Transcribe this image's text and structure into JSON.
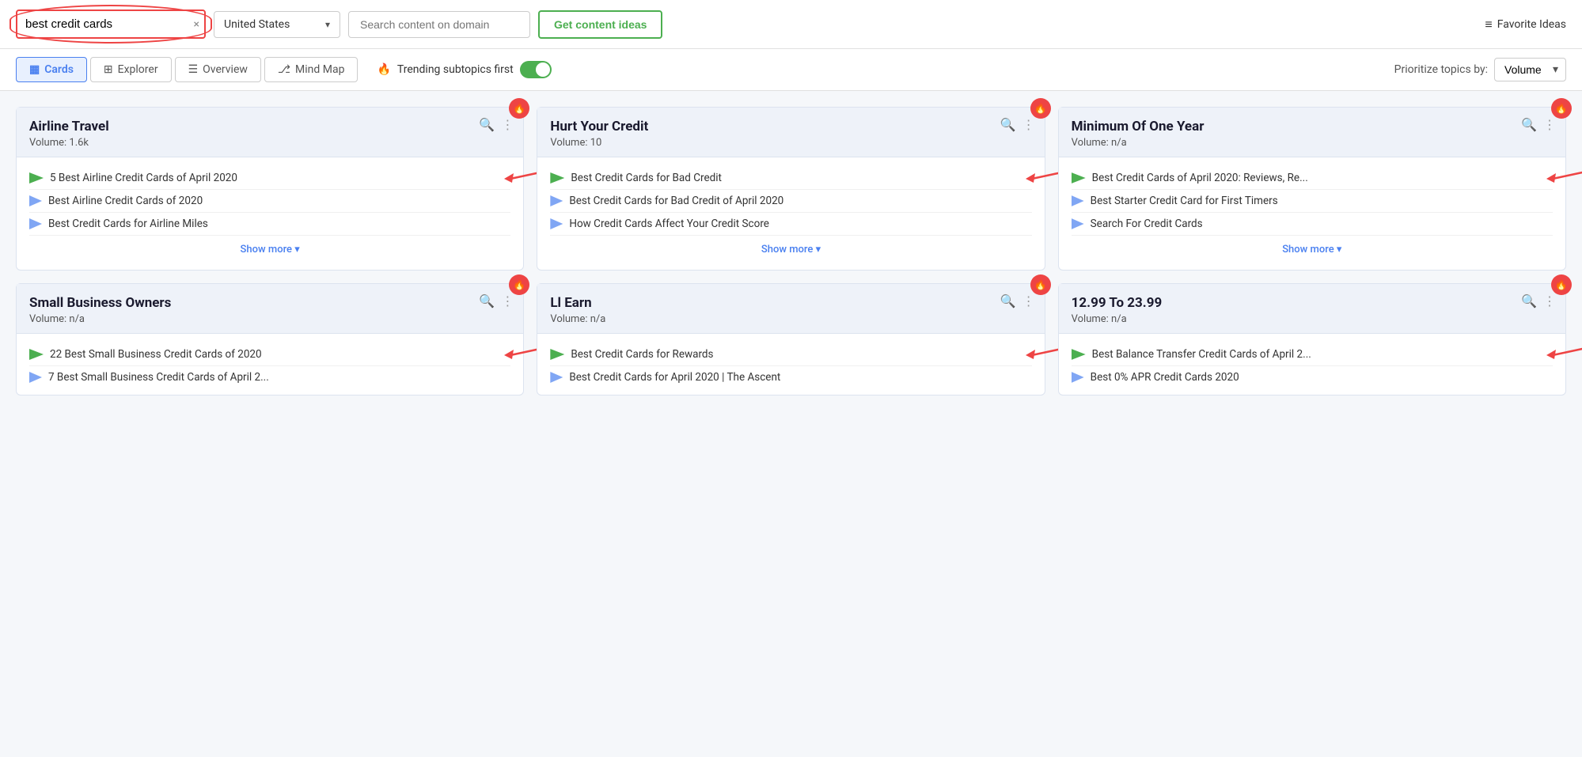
{
  "header": {
    "search_value": "best credit cards",
    "search_placeholder": "best credit cards",
    "clear_icon": "×",
    "country": "United States",
    "domain_placeholder": "Search content on domain",
    "get_ideas_label": "Get content ideas",
    "favorite_label": "Favorite Ideas"
  },
  "tabs": {
    "items": [
      {
        "id": "cards",
        "label": "Cards",
        "icon": "▦",
        "active": true
      },
      {
        "id": "explorer",
        "label": "Explorer",
        "icon": "⊞",
        "active": false
      },
      {
        "id": "overview",
        "label": "Overview",
        "icon": "☰",
        "active": false
      },
      {
        "id": "mindmap",
        "label": "Mind Map",
        "icon": "⎇",
        "active": false
      }
    ],
    "trending_label": "Trending subtopics first",
    "prioritize_label": "Prioritize topics by:",
    "volume_option": "Volume"
  },
  "cards": [
    {
      "id": "airline-travel",
      "title": "Airline Travel",
      "volume": "Volume: 1.6k",
      "items": [
        {
          "type": "green",
          "text": "5 Best Airline Credit Cards of April 2020",
          "has_arrow": true
        },
        {
          "type": "blue",
          "text": "Best Airline Credit Cards of 2020",
          "has_arrow": false
        },
        {
          "type": "blue",
          "text": "Best Credit Cards for Airline Miles",
          "has_arrow": false
        }
      ],
      "show_more": "Show more ▾"
    },
    {
      "id": "hurt-credit",
      "title": "Hurt Your Credit",
      "volume": "Volume: 10",
      "items": [
        {
          "type": "green",
          "text": "Best Credit Cards for Bad Credit",
          "has_arrow": true
        },
        {
          "type": "blue",
          "text": "Best Credit Cards for Bad Credit of April 2020",
          "has_arrow": false
        },
        {
          "type": "blue",
          "text": "How Credit Cards Affect Your Credit Score",
          "has_arrow": false
        }
      ],
      "show_more": "Show more ▾"
    },
    {
      "id": "minimum-one-year",
      "title": "Minimum Of One Year",
      "volume": "Volume: n/a",
      "items": [
        {
          "type": "green",
          "text": "Best Credit Cards of April 2020: Reviews, Re...",
          "has_arrow": true
        },
        {
          "type": "blue",
          "text": "Best Starter Credit Card for First Timers",
          "has_arrow": false
        },
        {
          "type": "blue",
          "text": "Search For Credit Cards",
          "has_arrow": false
        }
      ],
      "show_more": "Show more ▾"
    },
    {
      "id": "small-business",
      "title": "Small Business Owners",
      "volume": "Volume: n/a",
      "items": [
        {
          "type": "green",
          "text": "22 Best Small Business Credit Cards of 2020",
          "has_arrow": true
        },
        {
          "type": "blue",
          "text": "7 Best Small Business Credit Cards of April 2...",
          "has_arrow": false
        }
      ],
      "show_more": null
    },
    {
      "id": "ll-earn",
      "title": "Ll Earn",
      "volume": "Volume: n/a",
      "items": [
        {
          "type": "green",
          "text": "Best Credit Cards for Rewards",
          "has_arrow": true
        },
        {
          "type": "blue",
          "text": "Best Credit Cards for April 2020 | The Ascent",
          "has_arrow": false
        }
      ],
      "show_more": null
    },
    {
      "id": "12-to-23",
      "title": "12.99 To 23.99",
      "volume": "Volume: n/a",
      "items": [
        {
          "type": "green",
          "text": "Best Balance Transfer Credit Cards of April 2...",
          "has_arrow": true
        },
        {
          "type": "blue",
          "text": "Best 0% APR Credit Cards 2020",
          "has_arrow": false
        }
      ],
      "show_more": null
    }
  ]
}
